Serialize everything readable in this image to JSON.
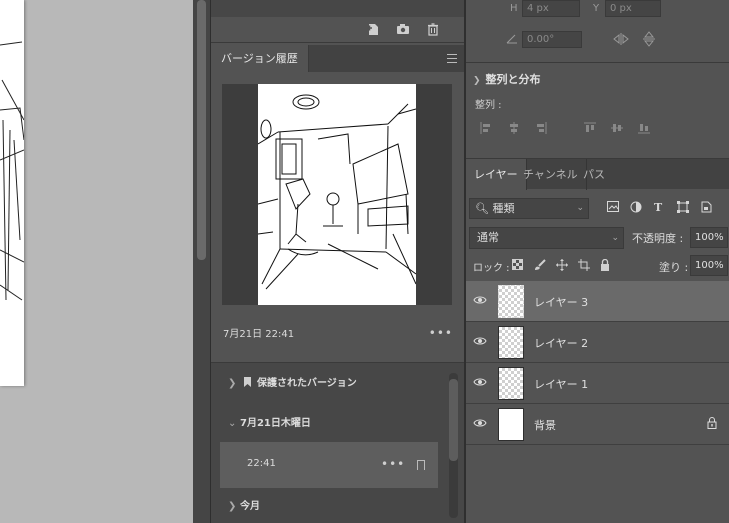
{
  "canvas": {},
  "history_panel": {
    "tab_label": "バージョン履歴",
    "preview_date": "7月21日 22:41",
    "more_label": "•••",
    "groups": {
      "protected": "保護されたバージョン",
      "day": "7月21日木曜日",
      "today": "今月"
    },
    "selected_version_time": "22:41"
  },
  "properties": {
    "h_label": "H",
    "h_value": "4 px",
    "y_label": "Y",
    "y_value": "0 px",
    "angle_value": "0.00°",
    "align_section": "整列と分布",
    "align_label": "整列 :"
  },
  "layers_panel": {
    "tabs": [
      "レイヤー",
      "チャンネル",
      "パス"
    ],
    "filter_label": "種類",
    "blend_mode": "通常",
    "opacity_label": "不透明度 :",
    "opacity_value": "100%",
    "lock_label": "ロック :",
    "fill_label": "塗り :",
    "fill_value": "100%",
    "layers": [
      {
        "name": "レイヤー 3",
        "selected": true
      },
      {
        "name": "レイヤー 2",
        "selected": false
      },
      {
        "name": "レイヤー 1",
        "selected": false
      },
      {
        "name": "背景",
        "selected": false,
        "locked": true
      }
    ]
  },
  "colors": {
    "panel_bg": "#535353",
    "canvas_bg": "#b8b8b8",
    "selected_layer": "#6a6a6a"
  }
}
